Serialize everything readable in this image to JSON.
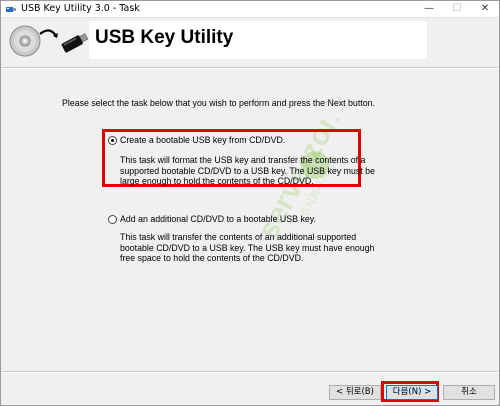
{
  "window": {
    "title": "USB Key Utility 3.0 - Task",
    "minimize_glyph": "—",
    "maximize_glyph": "☐",
    "close_glyph": "✕"
  },
  "header": {
    "title": "USB Key Utility",
    "icon": "cd-to-usb-icon"
  },
  "main": {
    "instruction": "Please select the task below that you wish to perform and press the Next button.",
    "options": [
      {
        "label": "Create a bootable USB key from CD/DVD.",
        "selected": true,
        "description": "This task will format the USB key and transfer the contents of a supported bootable CD/DVD to a USB key.  The USB key must be large enough to hold the contents of the CD/DVD."
      },
      {
        "label": "Add an additional CD/DVD to a bootable USB key.",
        "selected": false,
        "description": "This task will transfer the contents of an additional supported bootable CD/DVD to a USB key.  The USB key must have enough free space to hold the contents of the CD/DVD."
      }
    ]
  },
  "watermark": {
    "text": "serverzon",
    "subtext": "주식회사서버존"
  },
  "buttons": {
    "back": "< 뒤로(B)",
    "next": "다음(N) >",
    "cancel": "취소"
  },
  "colors": {
    "highlight": "#e00000",
    "watermark": "#7fc241"
  }
}
